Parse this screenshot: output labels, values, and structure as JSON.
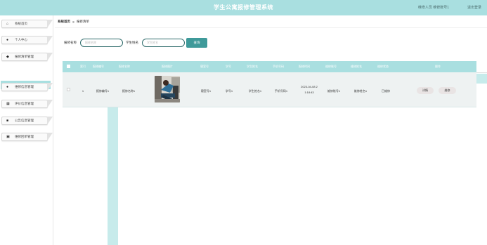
{
  "header": {
    "title": "学生公寓报修管理系统",
    "user_info": "维修人员 维修账号1",
    "logout": "退出登录"
  },
  "sidebar": {
    "items": [
      {
        "label": "系统首页",
        "icon": "home-icon"
      },
      {
        "label": "个人中心",
        "icon": "user-icon"
      },
      {
        "label": "报修清单管理",
        "icon": "location-icon"
      },
      {
        "label": "维修信息管理",
        "icon": "user-icon"
      },
      {
        "label": "评价信息管理",
        "icon": "grid-icon"
      },
      {
        "label": "公告信息管理",
        "icon": "bookmark-icon"
      },
      {
        "label": "维修回单管理",
        "icon": "doc-icon"
      }
    ],
    "active_sub": "报修清单"
  },
  "breadcrumb": {
    "home": "系统首页",
    "separator": "Ξ",
    "current": "报修清单"
  },
  "search": {
    "name_label": "报修名称",
    "name_placeholder": "报修名称",
    "student_label": "学生姓名",
    "student_placeholder": "学生姓名",
    "button": "查询"
  },
  "table": {
    "headers": [
      "索引",
      "报修编号",
      "报修名称",
      "报修图片",
      "寝室号",
      "学号",
      "学生姓名",
      "手机号码",
      "报修时间",
      "维修账号",
      "维修姓名",
      "维修状态",
      "操作"
    ],
    "rows": [
      {
        "index": "1",
        "number": "报修编号1",
        "name": "报修名称1",
        "room": "寝室号1",
        "student_no": "学号1",
        "student_name": "学生姓名1",
        "phone": "手机号码1",
        "time_line1": "2023-04-08 2",
        "time_line2": "1:18:43",
        "repair_account": "维修账号1",
        "repair_name": "维修姓名1",
        "status": "已维修",
        "actions": [
          "详情",
          "维修"
        ]
      }
    ]
  },
  "colors": {
    "accent": "#a9dfe0",
    "button": "#3f9a9a",
    "input_border": "#2e6b6b"
  }
}
